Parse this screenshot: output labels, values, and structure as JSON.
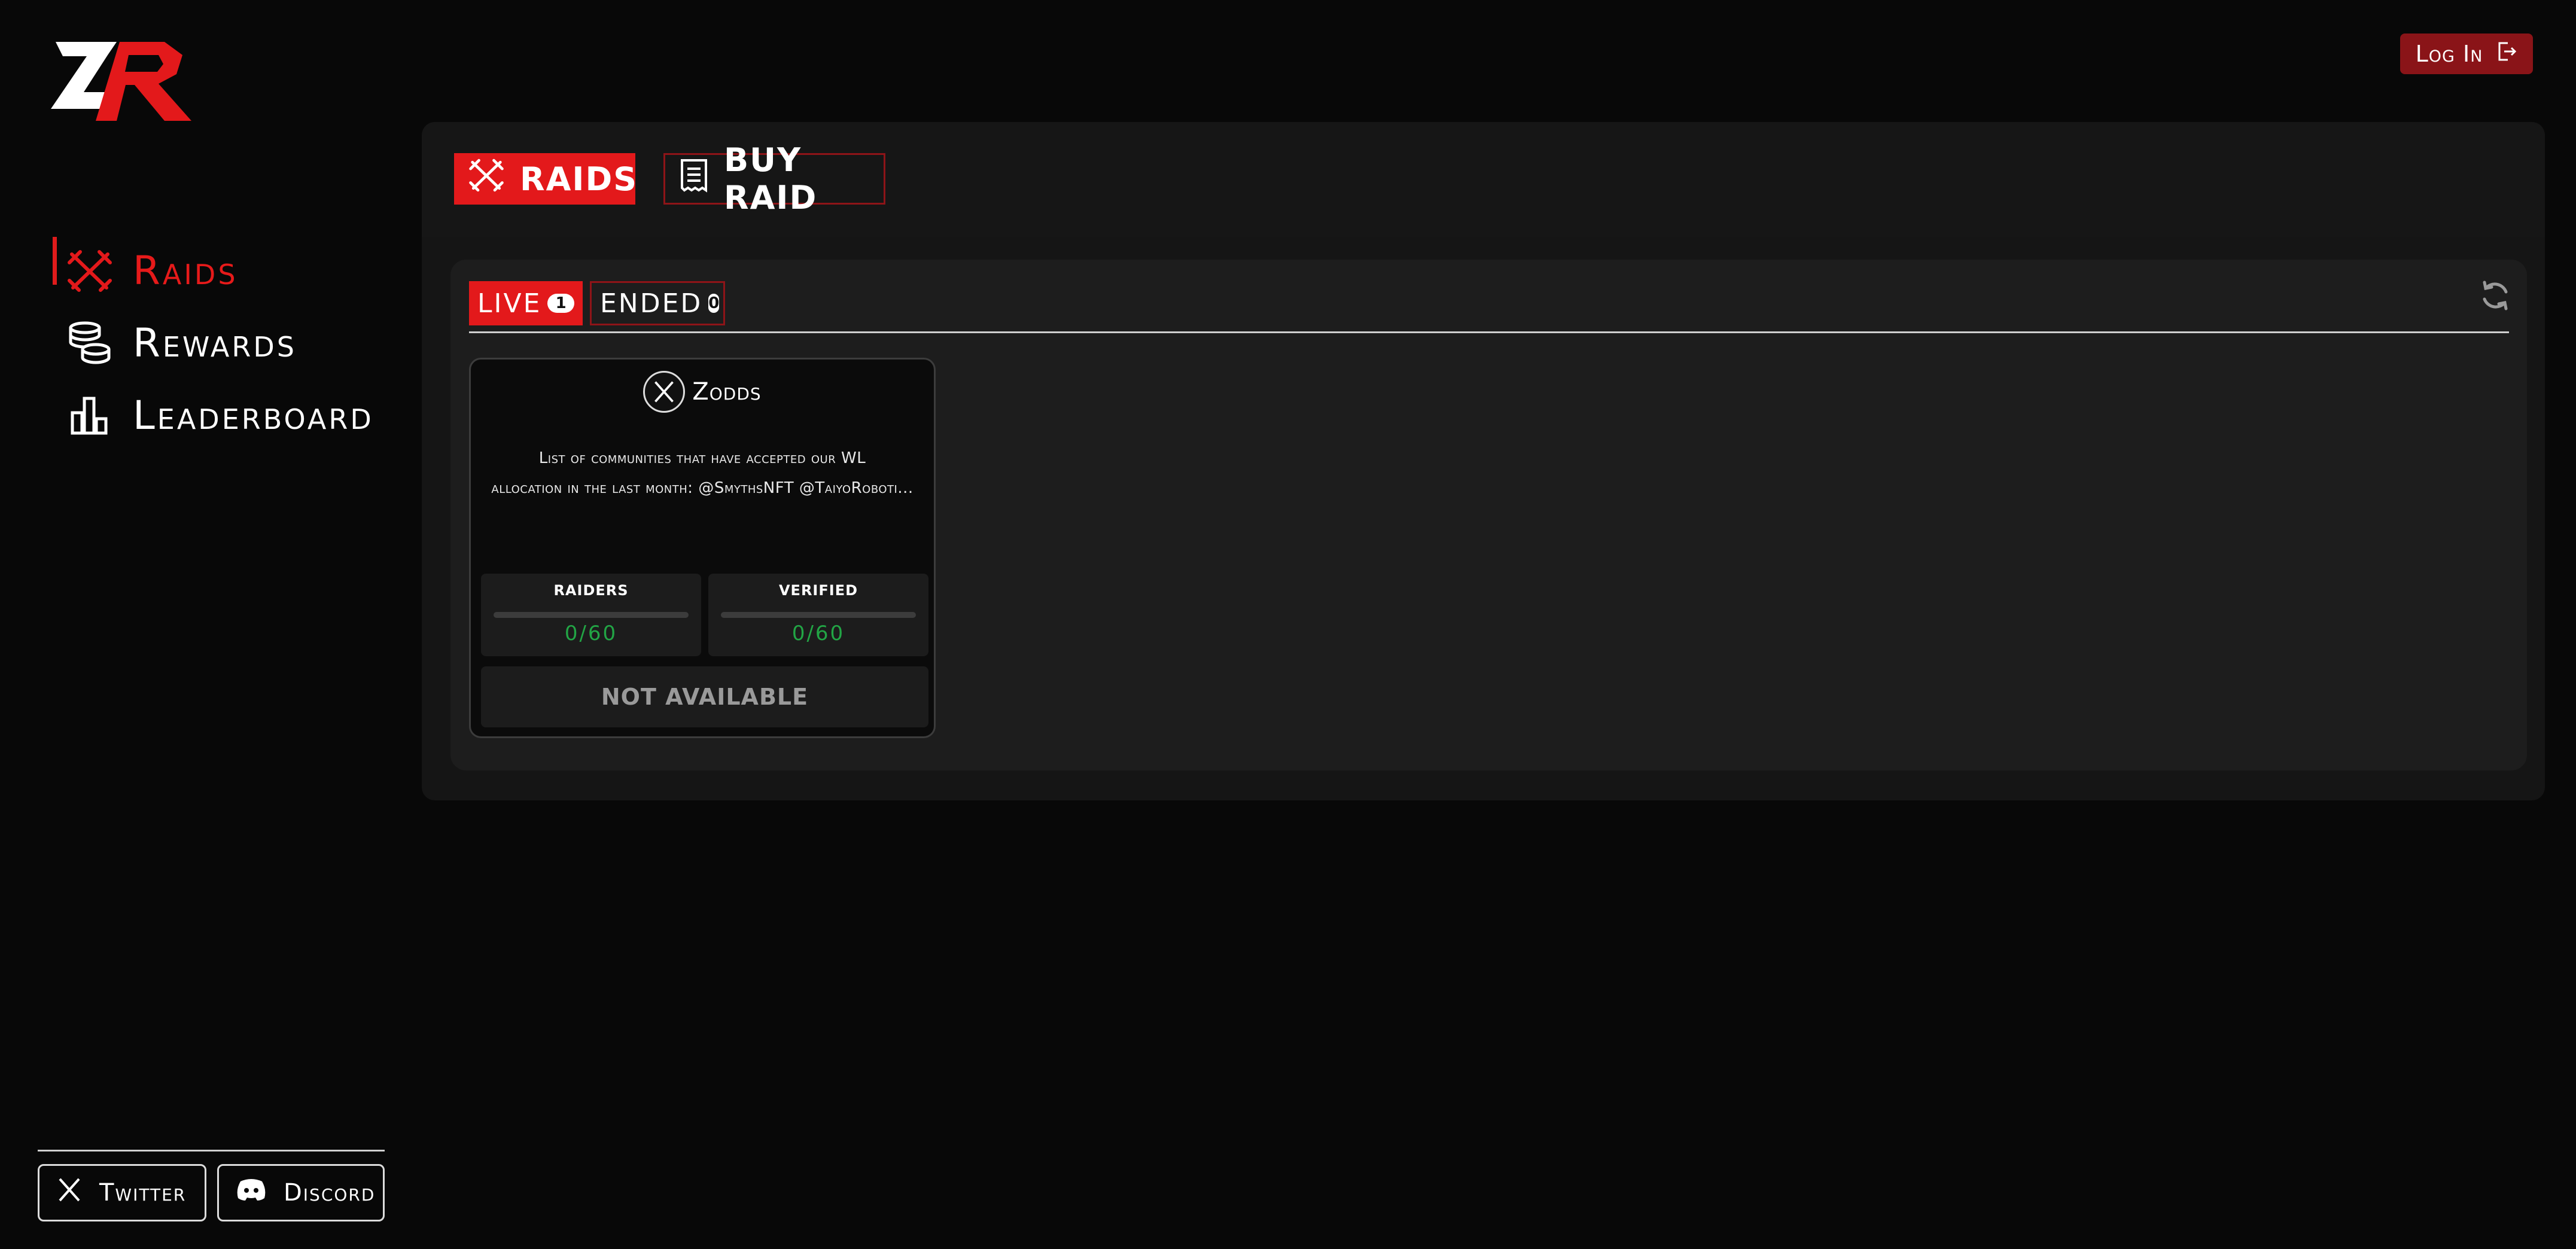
{
  "sidebar": {
    "logo_text": "ZR",
    "items": [
      {
        "label": "Raids",
        "icon": "raids-crossed-swords-icon",
        "active": true
      },
      {
        "label": "Rewards",
        "icon": "coin-stack-icon",
        "active": false
      },
      {
        "label": "Leaderboard",
        "icon": "bar-chart-icon",
        "active": false
      }
    ],
    "social": {
      "twitter": {
        "label": "Twitter",
        "icon": "x-logo-icon"
      },
      "discord": {
        "label": "Discord",
        "icon": "discord-logo-icon"
      }
    }
  },
  "header": {
    "login_label": "Log In",
    "login_icon": "logout-arrow-icon"
  },
  "main": {
    "tabs": [
      {
        "label": "RAIDS",
        "active": true,
        "icon": "raids-crossed-swords-icon"
      },
      {
        "label": "BUY RAID",
        "active": false,
        "icon": "receipt-icon"
      }
    ],
    "filters": [
      {
        "label": "LIVE",
        "count": "1",
        "active": true
      },
      {
        "label": "ENDED",
        "count": "0",
        "active": false
      }
    ],
    "refresh_icon": "refresh-icon"
  },
  "raid_card": {
    "name": "Zodds",
    "description_line1": "List of communities that have accepted our WL",
    "description_line2": "allocation in the last month: @SmythsNFT @TaiyoRoboti...",
    "stats": [
      {
        "title": "RAIDERS",
        "value": "0/60",
        "progress": 0
      },
      {
        "title": "VERIFIED",
        "value": "0/60",
        "progress": 0
      }
    ],
    "action_label": "NOT AVAILABLE"
  },
  "colors": {
    "accent": "#e3191b",
    "background": "#080808",
    "panel": "#151515",
    "login_bg": "#8a1418",
    "progress_text": "#22a545"
  }
}
